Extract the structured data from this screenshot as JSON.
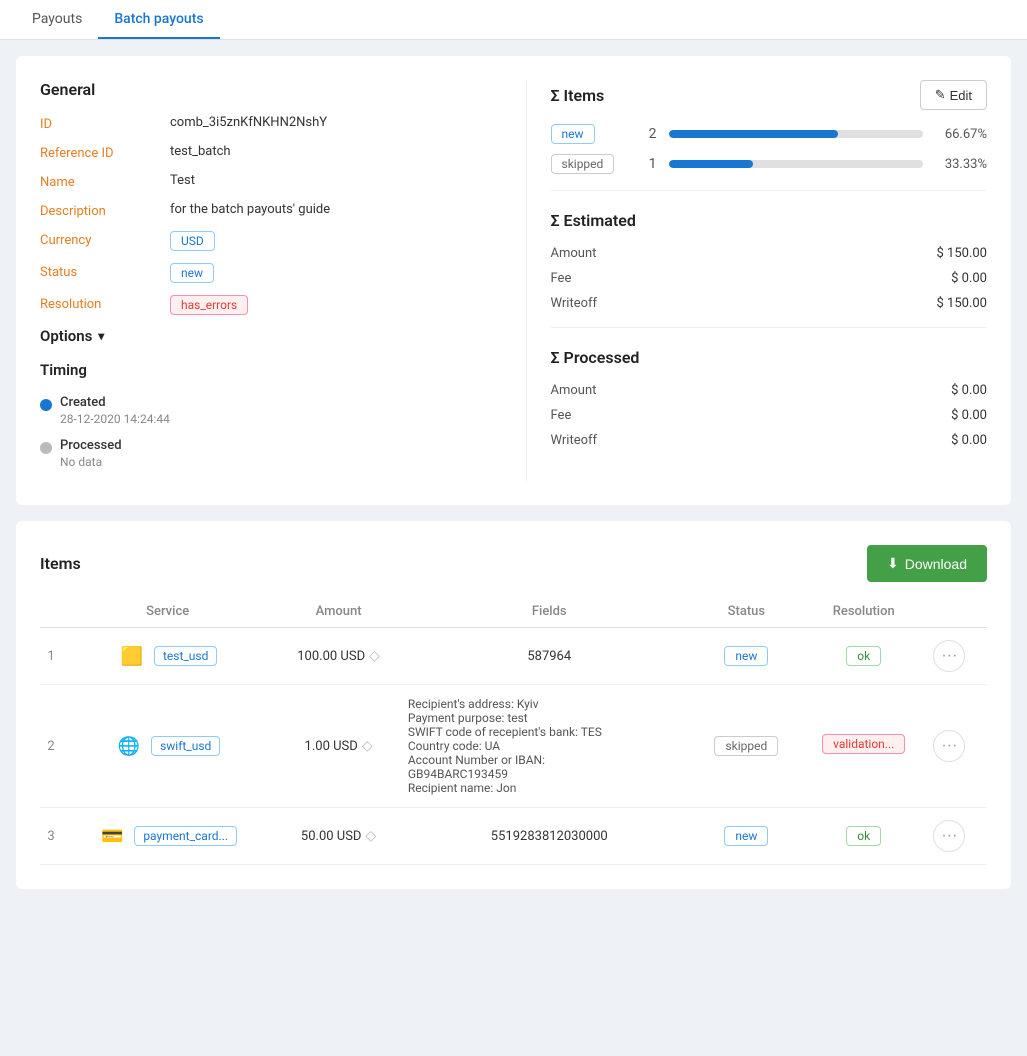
{
  "tabs": [
    {
      "id": "payouts",
      "label": "Payouts",
      "active": false
    },
    {
      "id": "batch-payouts",
      "label": "Batch payouts",
      "active": true
    }
  ],
  "general": {
    "title": "General",
    "fields": [
      {
        "label": "ID",
        "value": "comb_3i5znKfNKHN2NshY",
        "type": "text"
      },
      {
        "label": "Reference ID",
        "value": "test_batch",
        "type": "text"
      },
      {
        "label": "Name",
        "value": "Test",
        "type": "text"
      },
      {
        "label": "Description",
        "value": "for the batch payouts' guide",
        "type": "text"
      },
      {
        "label": "Currency",
        "value": "USD",
        "type": "badge-usd"
      },
      {
        "label": "Status",
        "value": "new",
        "type": "badge-new"
      },
      {
        "label": "Resolution",
        "value": "has_errors",
        "type": "badge-has-errors"
      }
    ]
  },
  "options": {
    "label": "Options",
    "chevron": "▾"
  },
  "timing": {
    "title": "Timing",
    "items": [
      {
        "label": "Created",
        "date": "28-12-2020 14:24:44",
        "active": true
      },
      {
        "label": "Processed",
        "date": "No data",
        "active": false
      }
    ]
  },
  "sigma_items": {
    "title": "Σ Items",
    "edit_label": "Edit",
    "rows": [
      {
        "badge": "new",
        "badge_type": "badge-new",
        "count": "2",
        "pct": "66.67%",
        "bar_pct": 66.67
      },
      {
        "badge": "skipped",
        "badge_type": "badge-skipped",
        "count": "1",
        "pct": "33.33%",
        "bar_pct": 33.33
      }
    ]
  },
  "estimated": {
    "title": "Σ Estimated",
    "rows": [
      {
        "label": "Amount",
        "value": "$ 150.00"
      },
      {
        "label": "Fee",
        "value": "$ 0.00"
      },
      {
        "label": "Writeoff",
        "value": "$ 150.00"
      }
    ]
  },
  "processed": {
    "title": "Σ Processed",
    "rows": [
      {
        "label": "Amount",
        "value": "$ 0.00"
      },
      {
        "label": "Fee",
        "value": "$ 0.00"
      },
      {
        "label": "Writeoff",
        "value": "$ 0.00"
      }
    ]
  },
  "items_section": {
    "title": "Items",
    "download_label": "Download",
    "table": {
      "headers": [
        "",
        "Service",
        "Amount",
        "Fields",
        "Status",
        "Resolution",
        ""
      ],
      "rows": [
        {
          "index": "1",
          "service_icon": "🟨",
          "service_label": "test_usd",
          "amount": "100.00 USD",
          "fields": "587964",
          "status": "new",
          "status_type": "badge-new",
          "resolution": "ok",
          "resolution_type": "badge-ok",
          "expanded": false
        },
        {
          "index": "2",
          "service_icon": "🌐",
          "service_label": "swift_usd",
          "amount": "1.00 USD",
          "fields": "Recipient's address: Kyiv\nPayment purpose: test\nSWIFT code of recepient's bank: TES\nCountry code: UA\nAccount Number or IBAN:\nGB94BARC193459\nRecipient name: Jon",
          "status": "skipped",
          "status_type": "badge-skipped",
          "resolution": "validation...",
          "resolution_type": "badge-validation",
          "expanded": true
        },
        {
          "index": "3",
          "service_icon": "💳",
          "service_label": "payment_card...",
          "amount": "50.00 USD",
          "fields": "5519283812030000",
          "status": "new",
          "status_type": "badge-new",
          "resolution": "ok",
          "resolution_type": "badge-ok",
          "expanded": false
        }
      ]
    }
  }
}
